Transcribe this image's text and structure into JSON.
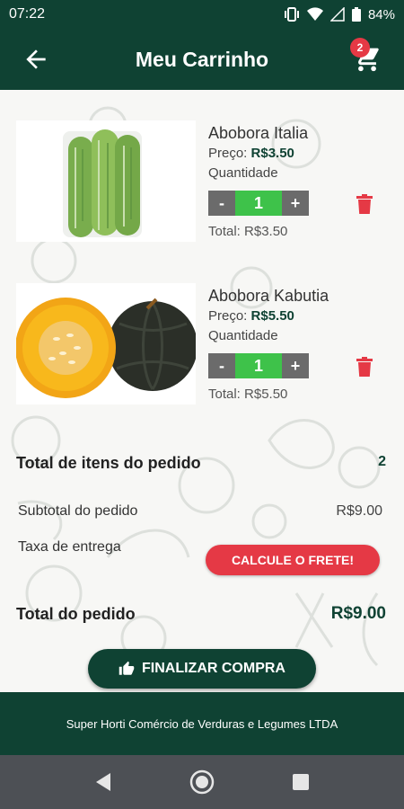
{
  "status": {
    "time": "07:22",
    "battery": "84%"
  },
  "header": {
    "title": "Meu Carrinho",
    "cart_count": "2"
  },
  "items": [
    {
      "name": "Abobora Italia",
      "price_label": "Preço:",
      "price": "R$3.50",
      "qty_label": "Quantidade",
      "minus": "-",
      "qty": "1",
      "plus": "+",
      "total": "Total: R$3.50"
    },
    {
      "name": "Abobora Kabutia",
      "price_label": "Preço:",
      "price": "R$5.50",
      "qty_label": "Quantidade",
      "minus": "-",
      "qty": "1",
      "plus": "+",
      "total": "Total: R$5.50"
    }
  ],
  "summary": {
    "items_label": "Total de itens do pedido",
    "items_count": "2",
    "subtotal_label": "Subtotal do pedido",
    "subtotal_value": "R$9.00",
    "delivery_label": "Taxa de entrega",
    "freight_button": "CALCULE O FRETE!",
    "total_label": "Total do pedido",
    "total_value": "R$9.00"
  },
  "checkout_button": "FINALIZAR COMPRA",
  "footer": {
    "text": "Super Horti Comércio de Verduras e Legumes LTDA"
  },
  "colors": {
    "primary": "#0f4233",
    "accent_red": "#e53945",
    "qty_green": "#3ec24a"
  }
}
